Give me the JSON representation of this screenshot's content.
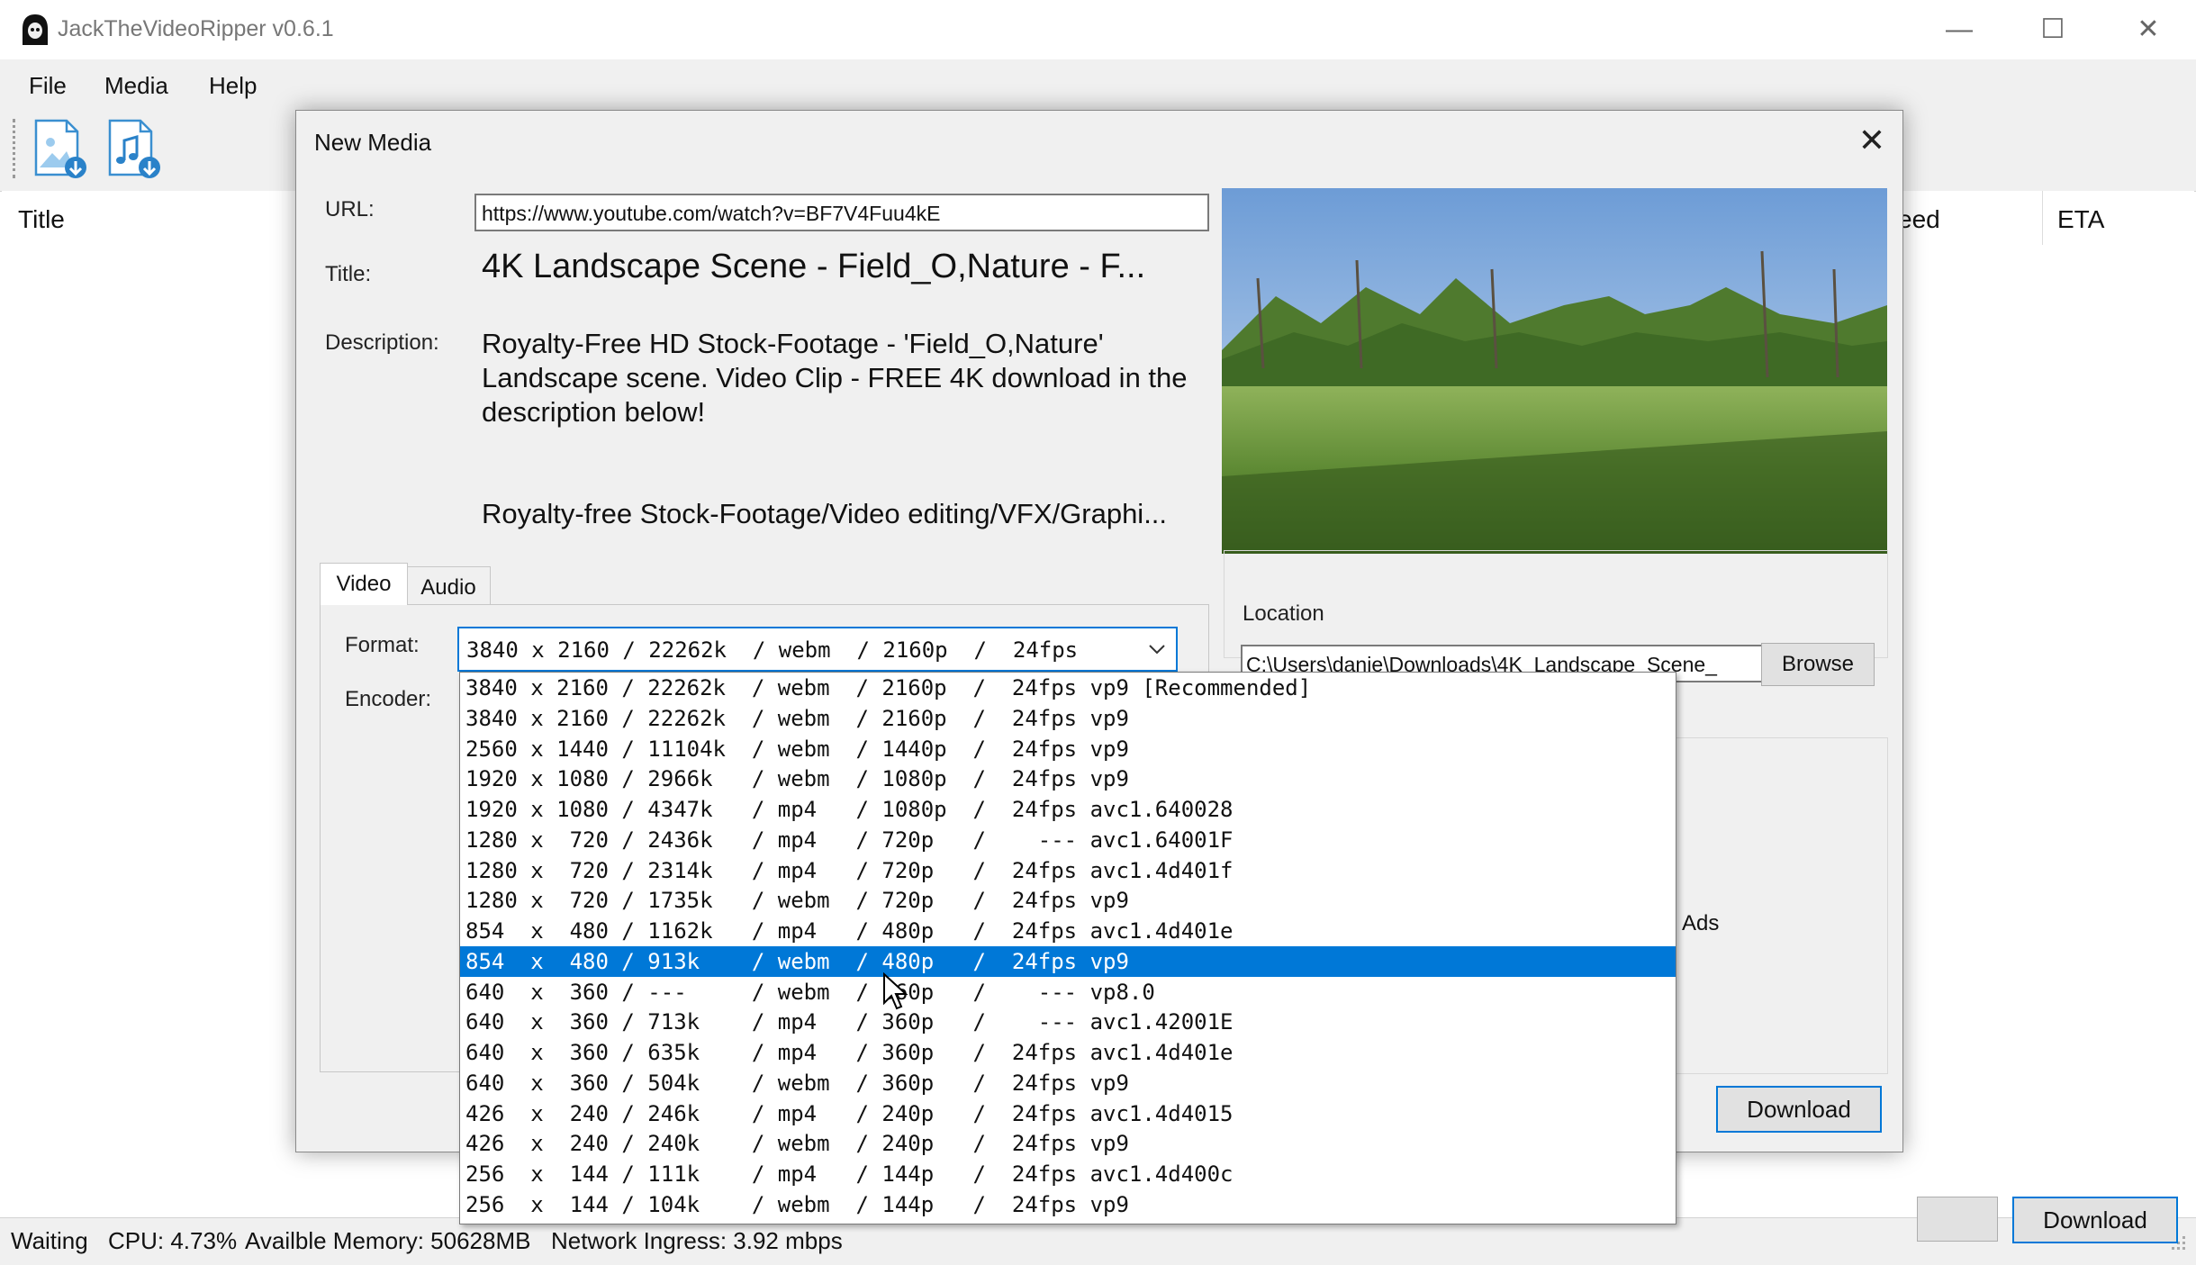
{
  "app": {
    "title": "JackTheVideoRipper v0.6.1"
  },
  "window_controls": {
    "minimize": "—",
    "maximize": "☐",
    "close": "✕"
  },
  "menu": [
    "File",
    "Media",
    "Help"
  ],
  "toolbar": {
    "buttons": [
      "add-video-icon",
      "add-audio-icon"
    ]
  },
  "list": {
    "columns": {
      "title": "Title",
      "speed": "eed",
      "eta": "ETA"
    }
  },
  "status": {
    "state": "Waiting",
    "cpu": "CPU: 4.73%",
    "memory": "Availble Memory: 50628MB",
    "network": "Network Ingress: 3.92 mbps"
  },
  "dialog": {
    "title": "New Media",
    "close": "✕",
    "url_label": "URL:",
    "url_value": "https://www.youtube.com/watch?v=BF7V4Fuu4kE",
    "title_label": "Title:",
    "title_value": "4K Landscape Scene - Field_O,Nature - F...",
    "description_label": "Description:",
    "description_value": "Royalty-Free HD Stock-Footage - 'Field_O,Nature' Landscape scene. Video Clip - FREE 4K download in the description below!",
    "description_more": "Royalty-free Stock-Footage/Video editing/VFX/Graphi...",
    "tabs": [
      "Video",
      "Audio"
    ],
    "format_label": "Format:",
    "encoder_label": "Encoder:",
    "format_selected": "3840 x 2160 / 22262k  / webm  / 2160p  /  24fps",
    "location_label": "Location",
    "location_value": "C:\\Users\\danie\\Downloads\\4K_Landscape_Scene_",
    "browse": "Browse",
    "ads_label": "Ads",
    "download": "Download",
    "format_options": [
      "3840 x 2160 / 22262k  / webm  / 2160p  /  24fps vp9 [Recommended]",
      "3840 x 2160 / 22262k  / webm  / 2160p  /  24fps vp9",
      "2560 x 1440 / 11104k  / webm  / 1440p  /  24fps vp9",
      "1920 x 1080 / 2966k   / webm  / 1080p  /  24fps vp9",
      "1920 x 1080 / 4347k   / mp4   / 1080p  /  24fps avc1.640028",
      "1280 x  720 / 2436k   / mp4   / 720p   /    --- avc1.64001F",
      "1280 x  720 / 2314k   / mp4   / 720p   /  24fps avc1.4d401f",
      "1280 x  720 / 1735k   / webm  / 720p   /  24fps vp9",
      "854  x  480 / 1162k   / mp4   / 480p   /  24fps avc1.4d401e",
      "854  x  480 / 913k    / webm  / 480p   /  24fps vp9",
      "640  x  360 / ---     / webm  / 360p   /    --- vp8.0",
      "640  x  360 / 713k    / mp4   / 360p   /    --- avc1.42001E",
      "640  x  360 / 635k    / mp4   / 360p   /  24fps avc1.4d401e",
      "640  x  360 / 504k    / webm  / 360p   /  24fps vp9",
      "426  x  240 / 246k    / mp4   / 240p   /  24fps avc1.4d4015",
      "426  x  240 / 240k    / webm  / 240p   /  24fps vp9",
      "256  x  144 / 111k    / mp4   / 144p   /  24fps avc1.4d400c",
      "256  x  144 / 104k    / webm  / 144p   /  24fps vp9"
    ],
    "highlighted_option": 9
  },
  "colors": {
    "accent": "#0078d7",
    "dialog_bg": "#f0f0f0"
  }
}
